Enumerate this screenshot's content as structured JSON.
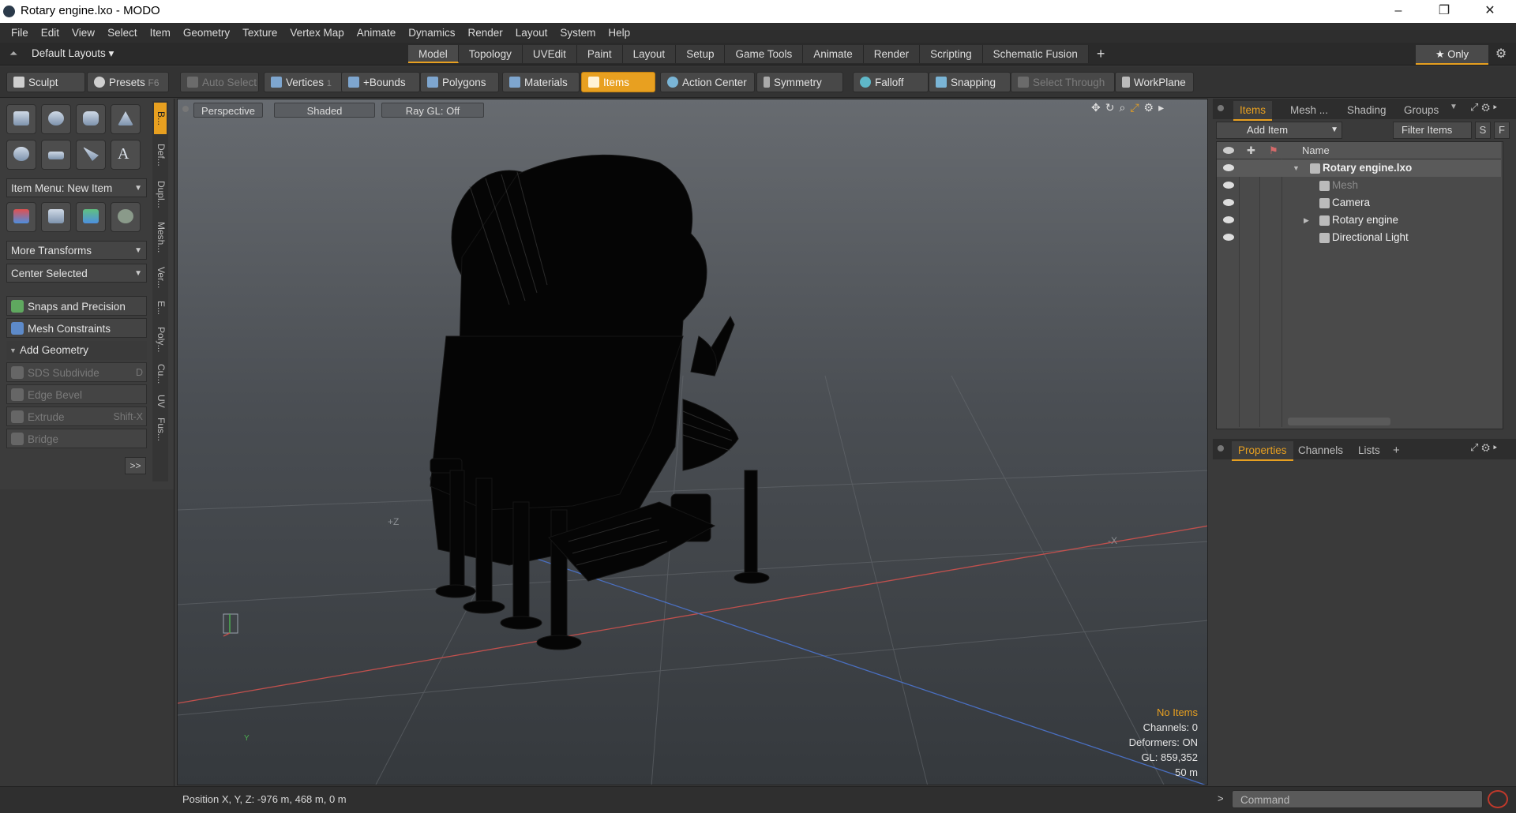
{
  "window": {
    "title": "Rotary engine.lxo - MODO",
    "minimize": "–",
    "maximize": "❐",
    "close": "✕"
  },
  "menu": [
    "File",
    "Edit",
    "View",
    "Select",
    "Item",
    "Geometry",
    "Texture",
    "Vertex Map",
    "Animate",
    "Dynamics",
    "Render",
    "Layout",
    "System",
    "Help"
  ],
  "layouts": {
    "selector": "Default Layouts ▾",
    "tabs": [
      "Model",
      "Topology",
      "UVEdit",
      "Paint",
      "Layout",
      "Setup",
      "Game Tools",
      "Animate",
      "Render",
      "Scripting",
      "Schematic Fusion"
    ],
    "active_tab": "Model",
    "plus": "+",
    "only": "★  Only"
  },
  "toolbar": {
    "sculpt": "Sculpt",
    "presets": "Presets",
    "presets_key": "F6",
    "auto_select": "Auto Select",
    "vertices": "Vertices",
    "vertices_count": "1",
    "bounds": "+Bounds",
    "polygons": "Polygons",
    "materials": "Materials",
    "items": "Items",
    "action_center": "Action Center",
    "symmetry": "Symmetry",
    "falloff": "Falloff",
    "snapping": "Snapping",
    "select_through": "Select Through",
    "workplane": "WorkPlane"
  },
  "left": {
    "item_menu": "Item Menu: New Item",
    "more_transforms": "More Transforms",
    "center_selected": "Center Selected",
    "snaps": "Snaps and Precision",
    "mesh_constraints": "Mesh Constraints",
    "add_geometry": "Add Geometry",
    "sds": "SDS Subdivide",
    "sds_key": "D",
    "edge_bevel": "Edge Bevel",
    "extrude": "Extrude",
    "extrude_key": "Shift-X",
    "bridge": "Bridge",
    "more": ">>",
    "vtabs": [
      "B...",
      "Def...",
      "Dupl...",
      "Mesh...",
      "Ver...",
      "E...",
      "Poly...",
      "Cu...",
      "UV",
      "Fus..."
    ]
  },
  "viewport": {
    "perspective": "Perspective",
    "shaded": "Shaded",
    "raygl": "Ray GL: Off",
    "stats": {
      "items": "No Items",
      "channels": "Channels: 0",
      "deformers": "Deformers: ON",
      "gl": "GL: 859,352",
      "scale": "50 m"
    },
    "axis_z": "+Z",
    "axis_x": "-X",
    "gizmo_y": "Y"
  },
  "items_panel": {
    "tabs": [
      "Items",
      "Mesh ...",
      "Shading",
      "Groups"
    ],
    "add_item": "Add Item",
    "filter": "Filter Items",
    "s": "S",
    "f": "F",
    "col_name": "Name",
    "tree": [
      {
        "label": "Rotary engine.lxo",
        "indent": 0,
        "expander": "▼",
        "bold": true,
        "dim": false
      },
      {
        "label": "Mesh",
        "indent": 1,
        "expander": "",
        "bold": false,
        "dim": true
      },
      {
        "label": "Camera",
        "indent": 1,
        "expander": "",
        "bold": false,
        "dim": false
      },
      {
        "label": "Rotary engine",
        "indent": 1,
        "expander": "▶",
        "bold": false,
        "dim": false
      },
      {
        "label": "Directional Light",
        "indent": 1,
        "expander": "",
        "bold": false,
        "dim": false
      }
    ]
  },
  "props_panel": {
    "tabs": [
      "Properties",
      "Channels",
      "Lists"
    ],
    "plus": "+"
  },
  "status": {
    "position": "Position X, Y, Z:   -976 m, 468 m, 0 m",
    "prompt": ">",
    "command_placeholder": "Command"
  },
  "colors": {
    "accent": "#e8a020",
    "background": "#3a3a3a"
  }
}
